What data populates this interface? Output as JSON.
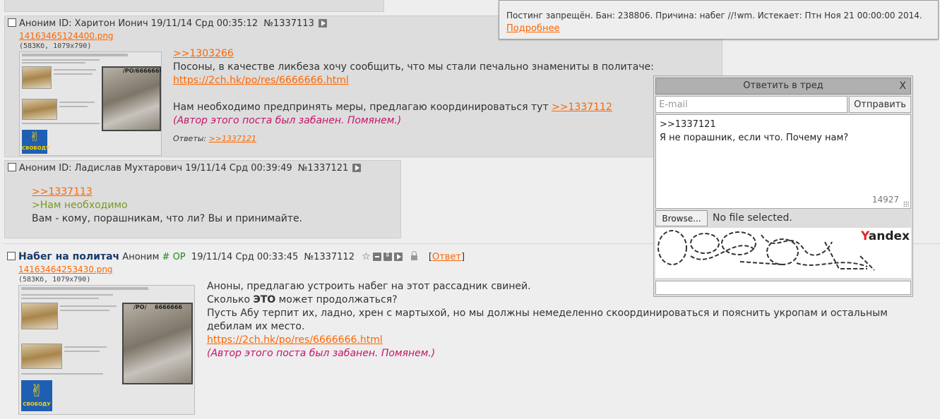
{
  "notice": {
    "text": "Постинг запрещён. Бан: 238806. Причина: набег //!wm. Истекает: Птн Ноя 21 00:00:00 2014.",
    "more_link": "Подробнее"
  },
  "posts": [
    {
      "name": "Аноним",
      "id_label": "ID: Харитон Ионич",
      "date": "19/11/14 Срд 00:35:12",
      "num": "№1337113",
      "file_name": "14163465124400.png",
      "file_info": "(583Кб, 1079x790)",
      "lines": [
        ">>1303266",
        "Посоны, в качестве ликбеза хочу сообщить, что мы стали печально знамениты в политаче:",
        "https://2ch.hk/po/res/6666666.html",
        "Нам необходимо предпринять меры, предлагаю координироваться тут",
        ">>1337112",
        "(Автор этого поста был забанен. Помянем.)"
      ],
      "answers_label": "Ответы:",
      "answers_link": ">>1337121"
    },
    {
      "name": "Аноним",
      "id_label": "ID: Ладислав Мухтарович",
      "date": "19/11/14 Срд 00:39:49",
      "num": "№1337121",
      "lines": [
        ">>1337113",
        ">Нам необходимо",
        "Вам - кому, порашникам, что ли? Вы и принимайте."
      ]
    },
    {
      "subject": "Набег на политач",
      "name": "Аноним",
      "trip": "# OP",
      "date": "19/11/14 Срд 00:33:45",
      "num": "№1337112",
      "reply_open": "[",
      "reply_link": "Ответ",
      "reply_close": "]",
      "file_name": "14163464253430.png",
      "file_info": "(583Кб, 1079x790)",
      "lines": [
        "Аноны, предлагаю устроить набег на этот рассадник свиней.",
        "Сколько",
        "ЭТО",
        "может продолжаться?",
        "Пусть Абу терпит их, ладно, хрен с мартыхой, но мы должны немеделенно скоординироваться и пояснить укропам и остальным",
        "дебилам их место.",
        "https://2ch.hk/po/res/6666666.html",
        "(Автор этого поста был забанен. Помянем.)"
      ]
    }
  ],
  "thumb": {
    "board_text": "/PO/",
    "thread_text": "6666666",
    "flag_text": "СВОБОДУ"
  },
  "quick_reply": {
    "title": "Ответить в тред",
    "close": "X",
    "email_placeholder": "E-mail",
    "send_label": "Отправить",
    "comment_lines": [
      ">>1337121",
      "Я не порашник, если что. Почему нам?"
    ],
    "counter": "14927",
    "browse_label": "Browse...",
    "no_file_label": "No file selected.",
    "captcha_brand_y": "Y",
    "captcha_brand_rest": "andex"
  }
}
